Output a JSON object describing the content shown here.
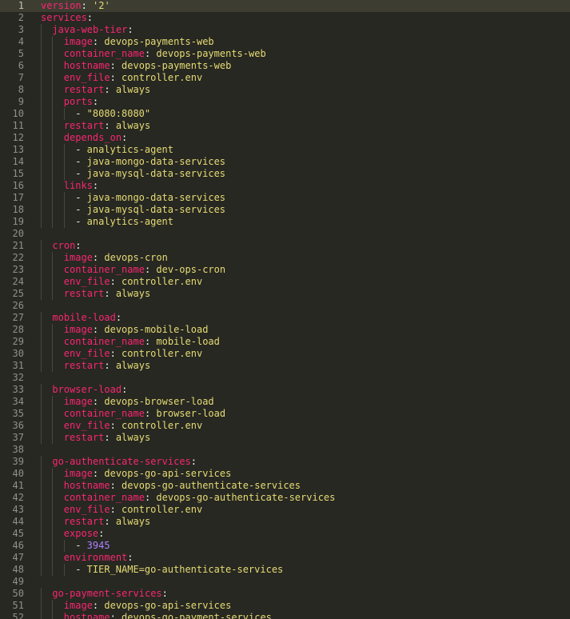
{
  "colors": {
    "background": "#272822",
    "current_line": "#3e3d32",
    "line_number": "#8f908a",
    "key": "#f92672",
    "string": "#e6db74",
    "number": "#ae81ff",
    "text": "#f8f8f2",
    "indent_guide": "#464741"
  },
  "editor": {
    "current_line": 1,
    "lines": [
      {
        "n": "1",
        "indent": 0,
        "tokens": [
          [
            "k",
            "version"
          ],
          [
            "p",
            ": "
          ],
          [
            "s",
            "'2'"
          ]
        ]
      },
      {
        "n": "2",
        "indent": 0,
        "tokens": [
          [
            "k",
            "services"
          ],
          [
            "p",
            ":"
          ]
        ]
      },
      {
        "n": "3",
        "indent": 2,
        "tokens": [
          [
            "k",
            "java-web-tier"
          ],
          [
            "p",
            ":"
          ]
        ]
      },
      {
        "n": "4",
        "indent": 4,
        "tokens": [
          [
            "k",
            "image"
          ],
          [
            "p",
            ": "
          ],
          [
            "s",
            "devops-payments-web"
          ]
        ]
      },
      {
        "n": "5",
        "indent": 4,
        "tokens": [
          [
            "k",
            "container_name"
          ],
          [
            "p",
            ": "
          ],
          [
            "s",
            "devops-payments-web"
          ]
        ]
      },
      {
        "n": "6",
        "indent": 4,
        "tokens": [
          [
            "k",
            "hostname"
          ],
          [
            "p",
            ": "
          ],
          [
            "s",
            "devops-payments-web"
          ]
        ]
      },
      {
        "n": "7",
        "indent": 4,
        "tokens": [
          [
            "k",
            "env_file"
          ],
          [
            "p",
            ": "
          ],
          [
            "s",
            "controller.env"
          ]
        ]
      },
      {
        "n": "8",
        "indent": 4,
        "tokens": [
          [
            "k",
            "restart"
          ],
          [
            "p",
            ": "
          ],
          [
            "s",
            "always"
          ]
        ]
      },
      {
        "n": "9",
        "indent": 4,
        "tokens": [
          [
            "k",
            "ports"
          ],
          [
            "p",
            ":"
          ]
        ]
      },
      {
        "n": "10",
        "indent": 6,
        "tokens": [
          [
            "p",
            "- "
          ],
          [
            "s",
            "\"8080:8080\""
          ]
        ]
      },
      {
        "n": "11",
        "indent": 4,
        "tokens": [
          [
            "k",
            "restart"
          ],
          [
            "p",
            ": "
          ],
          [
            "s",
            "always"
          ]
        ]
      },
      {
        "n": "12",
        "indent": 4,
        "tokens": [
          [
            "k",
            "depends_on"
          ],
          [
            "p",
            ":"
          ]
        ]
      },
      {
        "n": "13",
        "indent": 6,
        "tokens": [
          [
            "p",
            "- "
          ],
          [
            "s",
            "analytics-agent"
          ]
        ]
      },
      {
        "n": "14",
        "indent": 6,
        "tokens": [
          [
            "p",
            "- "
          ],
          [
            "s",
            "java-mongo-data-services"
          ]
        ]
      },
      {
        "n": "15",
        "indent": 6,
        "tokens": [
          [
            "p",
            "- "
          ],
          [
            "s",
            "java-mysql-data-services"
          ]
        ]
      },
      {
        "n": "16",
        "indent": 4,
        "tokens": [
          [
            "k",
            "links"
          ],
          [
            "p",
            ":"
          ]
        ]
      },
      {
        "n": "17",
        "indent": 6,
        "tokens": [
          [
            "p",
            "- "
          ],
          [
            "s",
            "java-mongo-data-services"
          ]
        ]
      },
      {
        "n": "18",
        "indent": 6,
        "tokens": [
          [
            "p",
            "- "
          ],
          [
            "s",
            "java-mysql-data-services"
          ]
        ]
      },
      {
        "n": "19",
        "indent": 6,
        "tokens": [
          [
            "p",
            "- "
          ],
          [
            "s",
            "analytics-agent"
          ]
        ]
      },
      {
        "n": "20",
        "indent": 0,
        "tokens": []
      },
      {
        "n": "21",
        "indent": 2,
        "tokens": [
          [
            "k",
            "cron"
          ],
          [
            "p",
            ":"
          ]
        ]
      },
      {
        "n": "22",
        "indent": 4,
        "tokens": [
          [
            "k",
            "image"
          ],
          [
            "p",
            ": "
          ],
          [
            "s",
            "devops-cron"
          ]
        ]
      },
      {
        "n": "23",
        "indent": 4,
        "tokens": [
          [
            "k",
            "container_name"
          ],
          [
            "p",
            ": "
          ],
          [
            "s",
            "dev-ops-cron"
          ]
        ]
      },
      {
        "n": "24",
        "indent": 4,
        "tokens": [
          [
            "k",
            "env_file"
          ],
          [
            "p",
            ": "
          ],
          [
            "s",
            "controller.env"
          ]
        ]
      },
      {
        "n": "25",
        "indent": 4,
        "tokens": [
          [
            "k",
            "restart"
          ],
          [
            "p",
            ": "
          ],
          [
            "s",
            "always"
          ]
        ]
      },
      {
        "n": "26",
        "indent": 0,
        "tokens": []
      },
      {
        "n": "27",
        "indent": 2,
        "tokens": [
          [
            "k",
            "mobile-load"
          ],
          [
            "p",
            ":"
          ]
        ]
      },
      {
        "n": "28",
        "indent": 4,
        "tokens": [
          [
            "k",
            "image"
          ],
          [
            "p",
            ": "
          ],
          [
            "s",
            "devops-mobile-load"
          ]
        ]
      },
      {
        "n": "29",
        "indent": 4,
        "tokens": [
          [
            "k",
            "container_name"
          ],
          [
            "p",
            ": "
          ],
          [
            "s",
            "mobile-load"
          ]
        ]
      },
      {
        "n": "30",
        "indent": 4,
        "tokens": [
          [
            "k",
            "env_file"
          ],
          [
            "p",
            ": "
          ],
          [
            "s",
            "controller.env"
          ]
        ]
      },
      {
        "n": "31",
        "indent": 4,
        "tokens": [
          [
            "k",
            "restart"
          ],
          [
            "p",
            ": "
          ],
          [
            "s",
            "always"
          ]
        ]
      },
      {
        "n": "32",
        "indent": 0,
        "tokens": []
      },
      {
        "n": "33",
        "indent": 2,
        "tokens": [
          [
            "k",
            "browser-load"
          ],
          [
            "p",
            ":"
          ]
        ]
      },
      {
        "n": "34",
        "indent": 4,
        "tokens": [
          [
            "k",
            "image"
          ],
          [
            "p",
            ": "
          ],
          [
            "s",
            "devops-browser-load"
          ]
        ]
      },
      {
        "n": "35",
        "indent": 4,
        "tokens": [
          [
            "k",
            "container_name"
          ],
          [
            "p",
            ": "
          ],
          [
            "s",
            "browser-load"
          ]
        ]
      },
      {
        "n": "36",
        "indent": 4,
        "tokens": [
          [
            "k",
            "env_file"
          ],
          [
            "p",
            ": "
          ],
          [
            "s",
            "controller.env"
          ]
        ]
      },
      {
        "n": "37",
        "indent": 4,
        "tokens": [
          [
            "k",
            "restart"
          ],
          [
            "p",
            ": "
          ],
          [
            "s",
            "always"
          ]
        ]
      },
      {
        "n": "38",
        "indent": 0,
        "tokens": []
      },
      {
        "n": "39",
        "indent": 2,
        "tokens": [
          [
            "k",
            "go-authenticate-services"
          ],
          [
            "p",
            ":"
          ]
        ]
      },
      {
        "n": "40",
        "indent": 4,
        "tokens": [
          [
            "k",
            "image"
          ],
          [
            "p",
            ": "
          ],
          [
            "s",
            "devops-go-api-services"
          ]
        ]
      },
      {
        "n": "41",
        "indent": 4,
        "tokens": [
          [
            "k",
            "hostname"
          ],
          [
            "p",
            ": "
          ],
          [
            "s",
            "devops-go-authenticate-services"
          ]
        ]
      },
      {
        "n": "42",
        "indent": 4,
        "tokens": [
          [
            "k",
            "container_name"
          ],
          [
            "p",
            ": "
          ],
          [
            "s",
            "devops-go-authenticate-services"
          ]
        ]
      },
      {
        "n": "43",
        "indent": 4,
        "tokens": [
          [
            "k",
            "env_file"
          ],
          [
            "p",
            ": "
          ],
          [
            "s",
            "controller.env"
          ]
        ]
      },
      {
        "n": "44",
        "indent": 4,
        "tokens": [
          [
            "k",
            "restart"
          ],
          [
            "p",
            ": "
          ],
          [
            "s",
            "always"
          ]
        ]
      },
      {
        "n": "45",
        "indent": 4,
        "tokens": [
          [
            "k",
            "expose"
          ],
          [
            "p",
            ":"
          ]
        ]
      },
      {
        "n": "46",
        "indent": 6,
        "tokens": [
          [
            "p",
            "- "
          ],
          [
            "n",
            "3945"
          ]
        ]
      },
      {
        "n": "47",
        "indent": 4,
        "tokens": [
          [
            "k",
            "environment"
          ],
          [
            "p",
            ":"
          ]
        ]
      },
      {
        "n": "48",
        "indent": 6,
        "tokens": [
          [
            "p",
            "- "
          ],
          [
            "s",
            "TIER_NAME=go-authenticate-services"
          ]
        ]
      },
      {
        "n": "49",
        "indent": 0,
        "tokens": []
      },
      {
        "n": "50",
        "indent": 2,
        "tokens": [
          [
            "k",
            "go-payment-services"
          ],
          [
            "p",
            ":"
          ]
        ]
      },
      {
        "n": "51",
        "indent": 4,
        "tokens": [
          [
            "k",
            "image"
          ],
          [
            "p",
            ": "
          ],
          [
            "s",
            "devops-go-api-services"
          ]
        ]
      },
      {
        "n": "52",
        "indent": 4,
        "tokens": [
          [
            "k",
            "hostname"
          ],
          [
            "p",
            ": "
          ],
          [
            "s",
            "devops-go-payment-services"
          ]
        ]
      }
    ]
  }
}
